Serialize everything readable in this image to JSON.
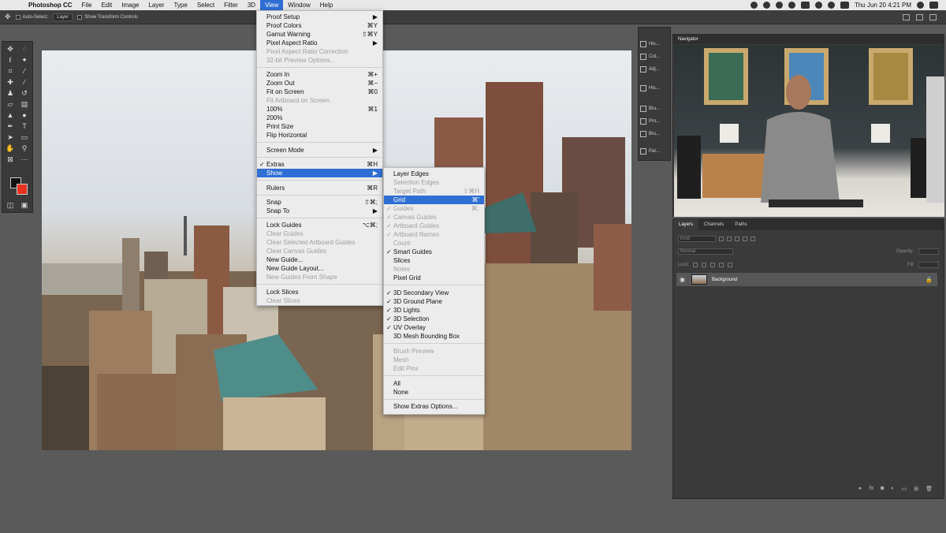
{
  "menubar": {
    "apple": "",
    "items": [
      {
        "label": "Photoshop CC"
      },
      {
        "label": "File"
      },
      {
        "label": "Edit"
      },
      {
        "label": "Image"
      },
      {
        "label": "Layer"
      },
      {
        "label": "Type"
      },
      {
        "label": "Select"
      },
      {
        "label": "Filter"
      },
      {
        "label": "3D"
      },
      {
        "label": "View"
      },
      {
        "label": "Window"
      },
      {
        "label": "Help"
      }
    ],
    "clock": "Thu Jun 20  4:21 PM"
  },
  "options": {
    "auto_select": "Auto-Select:",
    "layer_select": "Layer",
    "transform": "Show Transform Controls"
  },
  "view_menu": [
    {
      "label": "Proof Setup",
      "shortcut": "▶"
    },
    {
      "label": "Proof Colors",
      "shortcut": "⌘Y"
    },
    {
      "label": "Gamut Warning",
      "shortcut": "⇧⌘Y"
    },
    {
      "label": "Pixel Aspect Ratio",
      "shortcut": "▶"
    },
    {
      "label": "Pixel Aspect Ratio Correction",
      "shortcut": ""
    },
    {
      "label": "32-bit Preview Options...",
      "shortcut": ""
    },
    {
      "label": "Zoom In",
      "shortcut": "⌘+"
    },
    {
      "label": "Zoom Out",
      "shortcut": "⌘−"
    },
    {
      "label": "Fit on Screen",
      "shortcut": "⌘0"
    },
    {
      "label": "Fit Artboard on Screen",
      "shortcut": ""
    },
    {
      "label": "100%",
      "shortcut": "⌘1"
    },
    {
      "label": "200%",
      "shortcut": ""
    },
    {
      "label": "Print Size",
      "shortcut": ""
    },
    {
      "label": "Flip Horizontal",
      "shortcut": ""
    },
    {
      "label": "Screen Mode",
      "shortcut": "▶"
    },
    {
      "label": "Extras",
      "shortcut": "⌘H"
    },
    {
      "label": "Show",
      "shortcut": "▶"
    },
    {
      "label": "Rulers",
      "shortcut": "⌘R"
    },
    {
      "label": "Snap",
      "shortcut": "⇧⌘;"
    },
    {
      "label": "Snap To",
      "shortcut": "▶"
    },
    {
      "label": "Lock Guides",
      "shortcut": "⌥⌘;"
    },
    {
      "label": "Clear Guides",
      "shortcut": ""
    },
    {
      "label": "Clear Selected Artboard Guides",
      "shortcut": ""
    },
    {
      "label": "Clear Canvas Guides",
      "shortcut": ""
    },
    {
      "label": "New Guide...",
      "shortcut": ""
    },
    {
      "label": "New Guide Layout...",
      "shortcut": ""
    },
    {
      "label": "New Guides From Shape",
      "shortcut": ""
    },
    {
      "label": "Lock Slices",
      "shortcut": ""
    },
    {
      "label": "Clear Slices",
      "shortcut": ""
    }
  ],
  "show_menu": [
    {
      "label": "Layer Edges",
      "shortcut": ""
    },
    {
      "label": "Selection Edges",
      "shortcut": ""
    },
    {
      "label": "Target Path",
      "shortcut": "⇧⌘H"
    },
    {
      "label": "Grid",
      "shortcut": "⌘'"
    },
    {
      "label": "Guides",
      "shortcut": "⌘;"
    },
    {
      "label": "Canvas Guides",
      "shortcut": ""
    },
    {
      "label": "Artboard Guides",
      "shortcut": ""
    },
    {
      "label": "Artboard Names",
      "shortcut": ""
    },
    {
      "label": "Count",
      "shortcut": ""
    },
    {
      "label": "Smart Guides",
      "shortcut": ""
    },
    {
      "label": "Slices",
      "shortcut": ""
    },
    {
      "label": "Notes",
      "shortcut": ""
    },
    {
      "label": "Pixel Grid",
      "shortcut": ""
    },
    {
      "label": "3D Secondary View",
      "shortcut": ""
    },
    {
      "label": "3D Ground Plane",
      "shortcut": ""
    },
    {
      "label": "3D Lights",
      "shortcut": ""
    },
    {
      "label": "3D Selection",
      "shortcut": ""
    },
    {
      "label": "UV Overlay",
      "shortcut": ""
    },
    {
      "label": "3D Mesh Bounding Box",
      "shortcut": ""
    },
    {
      "label": "Brush Preview",
      "shortcut": ""
    },
    {
      "label": "Mesh",
      "shortcut": ""
    },
    {
      "label": "Edit Pins",
      "shortcut": ""
    },
    {
      "label": "All",
      "shortcut": ""
    },
    {
      "label": "None",
      "shortcut": ""
    },
    {
      "label": "Show Extras Options...",
      "shortcut": ""
    }
  ],
  "collapsed_panels": [
    {
      "label": "His..."
    },
    {
      "label": "Col..."
    },
    {
      "label": "Adj..."
    },
    {
      "label": "His..."
    },
    {
      "label": "Bru..."
    },
    {
      "label": "Pro..."
    },
    {
      "label": "Bru..."
    },
    {
      "label": "Par..."
    }
  ],
  "navigator": {
    "title": "Navigator"
  },
  "layers": {
    "tabs": [
      "Layers",
      "Channels",
      "Paths"
    ],
    "kind": "Kind",
    "blend": "Normal",
    "opacity_label": "Opacity:",
    "lock_label": "Lock:",
    "fill_label": "Fill:",
    "layer_name": "Background"
  },
  "colors": {
    "menu_highlight": "#2f6fd3",
    "foreground": "#111111",
    "background": "#e8321f"
  }
}
